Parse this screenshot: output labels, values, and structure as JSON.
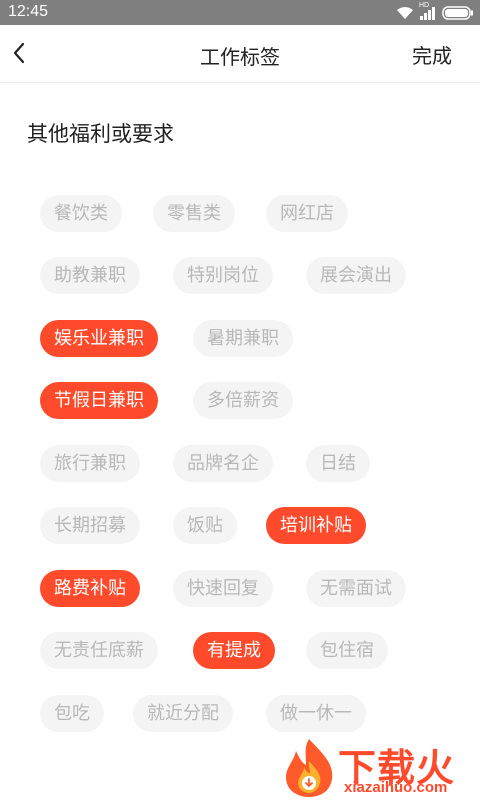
{
  "status_bar": {
    "time": "12:45",
    "network_label": "HD"
  },
  "header": {
    "title": "工作标签",
    "done_label": "完成"
  },
  "section": {
    "title": "其他福利或要求"
  },
  "tags": [
    {
      "label": "餐饮类",
      "selected": false
    },
    {
      "label": "零售类",
      "selected": false
    },
    {
      "label": "网红店",
      "selected": false
    },
    {
      "label": "助教兼职",
      "selected": false
    },
    {
      "label": "特别岗位",
      "selected": false
    },
    {
      "label": "展会演出",
      "selected": false
    },
    {
      "label": "娱乐业兼职",
      "selected": true
    },
    {
      "label": "暑期兼职",
      "selected": false
    },
    {
      "label": "节假日兼职",
      "selected": true
    },
    {
      "label": "多倍薪资",
      "selected": false
    },
    {
      "label": "旅行兼职",
      "selected": false
    },
    {
      "label": "品牌名企",
      "selected": false
    },
    {
      "label": "日结",
      "selected": false
    },
    {
      "label": "长期招募",
      "selected": false
    },
    {
      "label": "饭贴",
      "selected": false
    },
    {
      "label": "培训补贴",
      "selected": true
    },
    {
      "label": "路费补贴",
      "selected": true
    },
    {
      "label": "快速回复",
      "selected": false
    },
    {
      "label": "无需面试",
      "selected": false
    },
    {
      "label": "无责任底薪",
      "selected": false
    },
    {
      "label": "有提成",
      "selected": true
    },
    {
      "label": "包住宿",
      "selected": false
    },
    {
      "label": "包吃",
      "selected": false
    },
    {
      "label": "就近分配",
      "selected": false
    },
    {
      "label": "做一休一",
      "selected": false
    }
  ],
  "colors": {
    "accent": "#ff4a2c",
    "tag_bg": "#f4f4f4",
    "tag_text": "#b8b8b8"
  },
  "watermark": {
    "text": "下载火",
    "sub": "xiazaihuo.com"
  }
}
